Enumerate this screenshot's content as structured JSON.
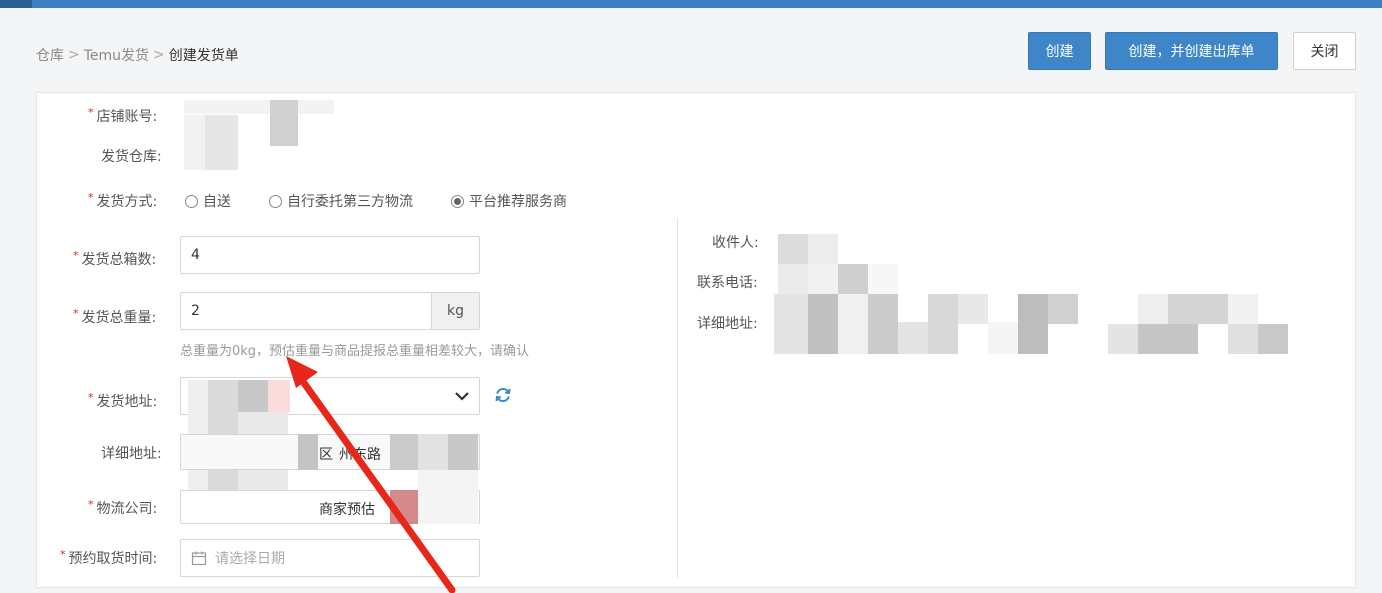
{
  "breadcrumb": {
    "items": [
      "仓库",
      "Temu发货",
      "创建发货单"
    ],
    "separator": ">"
  },
  "actions": {
    "create": "创建",
    "create_and_out": "创建，并创建出库单",
    "close": "关闭"
  },
  "form": {
    "store_account_label": "店铺账号:",
    "warehouse_label": "发货仓库:",
    "ship_method_label": "发货方式:",
    "ship_methods": [
      {
        "label": "自送",
        "checked": false
      },
      {
        "label": "自行委托第三方物流",
        "checked": false
      },
      {
        "label": "平台推荐服务商",
        "checked": true
      }
    ],
    "total_boxes_label": "发货总箱数:",
    "total_boxes_value": "4",
    "total_weight_label": "发货总重量:",
    "total_weight_value": "2",
    "weight_unit": "kg",
    "weight_hint": "总重量为0kg，预估重量与商品提报总重量相差较大，请确认",
    "ship_address_label": "发货地址:",
    "detail_address_label": "详细地址:",
    "detail_address_partial": "区",
    "detail_address_partial2": "州东路",
    "logistics_label": "物流公司:",
    "logistics_partial": "商家预估",
    "pickup_time_label": "预约取货时间:",
    "pickup_time_placeholder": "请选择日期"
  },
  "receiver": {
    "name_label": "收件人:",
    "phone_label": "联系电话:",
    "address_label": "详细地址:"
  },
  "colors": {
    "primary": "#3f86c9",
    "topbar": "#3a80c3",
    "required": "#d9261c",
    "arrow": "#e8271b"
  }
}
